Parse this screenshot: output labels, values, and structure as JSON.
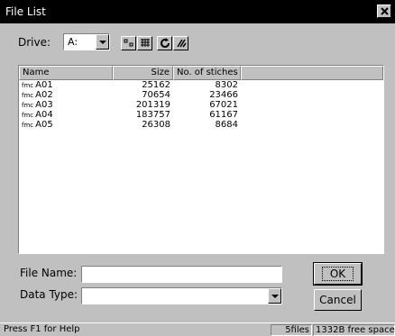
{
  "window": {
    "title": "File List"
  },
  "drive": {
    "label": "Drive:",
    "value": "A:"
  },
  "toolbar": {
    "icons": [
      "list-view-icon",
      "detail-view-icon",
      "refresh-icon",
      "disk-icon"
    ]
  },
  "list": {
    "columns": [
      "Name",
      "Size",
      "No. of stiches"
    ],
    "file_icon_text": "fmc",
    "rows": [
      {
        "name": "A01",
        "size": "25162",
        "stitches": "8302"
      },
      {
        "name": "A02",
        "size": "70654",
        "stitches": "23466"
      },
      {
        "name": "A03",
        "size": "201319",
        "stitches": "67021"
      },
      {
        "name": "A04",
        "size": "183757",
        "stitches": "61167"
      },
      {
        "name": "A05",
        "size": "26308",
        "stitches": "8684"
      }
    ]
  },
  "form": {
    "file_name_label": "File Name:",
    "file_name_value": "",
    "data_type_label": "Data Type:",
    "data_type_value": ""
  },
  "buttons": {
    "ok": "OK",
    "cancel": "Cancel"
  },
  "status": {
    "help": "Press F1 for Help",
    "files": "5files",
    "free": "1332B free space"
  }
}
